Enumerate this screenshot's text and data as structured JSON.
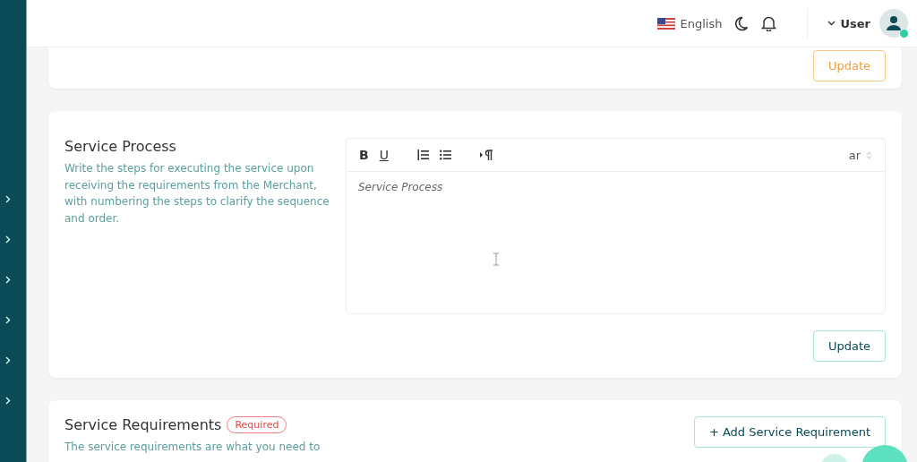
{
  "header": {
    "language": "English",
    "user": "User",
    "user_online": true
  },
  "sidebar": {
    "items": [
      {
        "kind": "collapsed"
      },
      {
        "kind": "collapsed"
      },
      {
        "kind": "collapsed"
      },
      {
        "kind": "collapsed"
      },
      {
        "kind": "collapsed"
      },
      {
        "kind": "collapsed"
      }
    ]
  },
  "sections": [
    {
      "kind": "button-only",
      "button": "Update",
      "button_pending": true
    },
    {
      "kind": "editor",
      "title": "Service Process",
      "description": "Write the steps for executing the service upon receiving the requirements from the Merchant, with numbering the steps to clarify the sequence and order.",
      "editor": {
        "toolbar": [
          "B",
          "U"
        ],
        "language": "ar",
        "placeholder": "Service Process"
      },
      "button": "Update",
      "button_pending": false
    },
    {
      "kind": "list",
      "title": "Service Requirements",
      "badge": "Required",
      "description": "The service requirements are what you need to",
      "button": "+ Add Service Requirement",
      "button_pending": false
    }
  ]
}
